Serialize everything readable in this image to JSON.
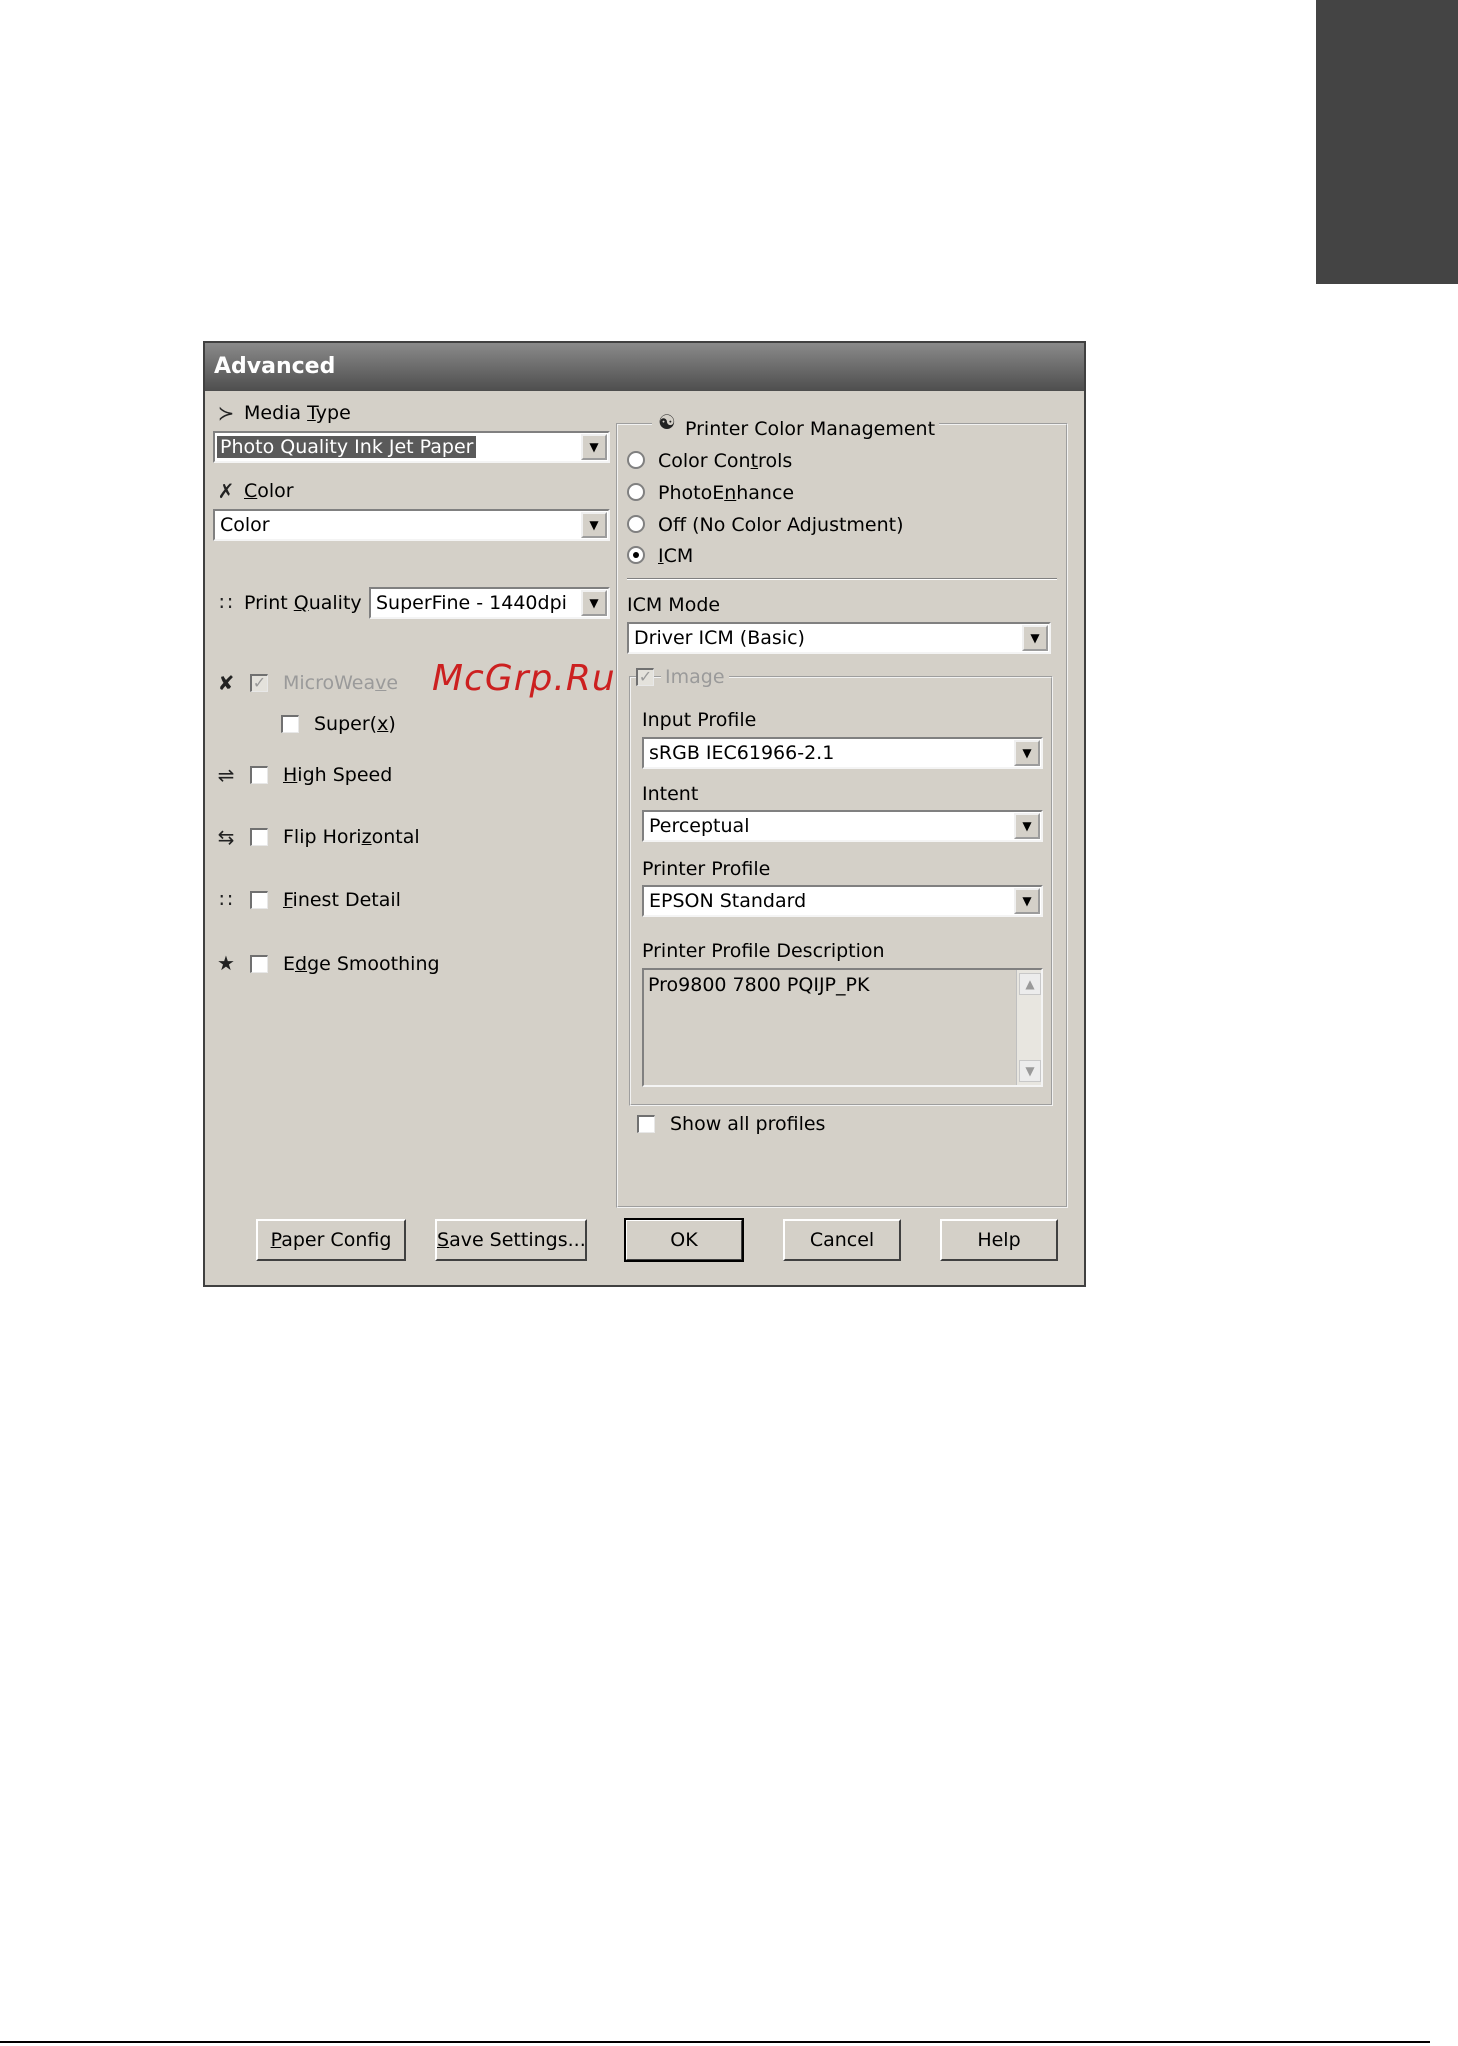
{
  "dialog": {
    "title": "Advanced",
    "media_type": {
      "label_prefix": "Media ",
      "label_access": "T",
      "label_suffix": "ype",
      "value": "Photo Quality Ink Jet Paper"
    },
    "color": {
      "label_access": "C",
      "label_suffix": "olor",
      "value": "Color"
    },
    "print_quality": {
      "label_prefix": "Print ",
      "label_access": "Q",
      "label_suffix": "uality",
      "value": "SuperFine - 1440dpi"
    },
    "options": {
      "microweave": {
        "label_prefix": "MicroWea",
        "label_access": "v",
        "label_suffix": "e",
        "checked": true,
        "disabled": true
      },
      "super": {
        "label_prefix": "Super(",
        "label_access": "x",
        "label_suffix": ")",
        "checked": false
      },
      "high_speed": {
        "label_access": "H",
        "label_suffix": "igh Speed",
        "checked": false
      },
      "flip_horizontal": {
        "label_prefix": "Flip Hori",
        "label_access": "z",
        "label_suffix": "ontal",
        "checked": false
      },
      "finest_detail": {
        "label_access": "F",
        "label_suffix": "inest Detail",
        "checked": false
      },
      "edge_smoothing": {
        "label_prefix": "E",
        "label_access": "d",
        "label_suffix": "ge Smoothing",
        "checked": false
      }
    },
    "color_management": {
      "group_label": "Printer Color Management",
      "radios": [
        {
          "label_prefix": "Color Con",
          "label_access": "t",
          "label_suffix": "rols",
          "selected": false
        },
        {
          "label_prefix": "PhotoE",
          "label_access": "n",
          "label_suffix": "hance",
          "selected": false
        },
        {
          "label_prefix": "Off (No Color Adjustment)",
          "label_access": "",
          "label_suffix": "",
          "selected": false
        },
        {
          "label_prefix": "",
          "label_access": "I",
          "label_suffix": "CM",
          "selected": true
        }
      ],
      "icm_mode_label": "ICM Mode",
      "icm_mode_value": "Driver ICM (Basic)",
      "image": {
        "label": "Image",
        "checked": true,
        "disabled": true,
        "input_profile_label": "Input Profile",
        "input_profile_value": "sRGB IEC61966-2.1",
        "intent_label": "Intent",
        "intent_value": "Perceptual",
        "printer_profile_label": "Printer Profile",
        "printer_profile_value": "EPSON Standard",
        "printer_profile_description_label": "Printer Profile Description",
        "printer_profile_description": "Pro9800 7800 PQIJP_PK"
      },
      "show_all_profiles_label": "Show all profiles",
      "show_all_profiles_checked": false
    },
    "buttons": {
      "paper_config": {
        "access": "P",
        "rest": "aper Config"
      },
      "save_settings": {
        "access": "S",
        "rest": "ave Settings..."
      },
      "ok": "OK",
      "cancel": "Cancel",
      "help": "Help"
    }
  },
  "watermark": "McGrp.Ru",
  "icons": {
    "media_type": "media-type-icon",
    "color": "color-icon",
    "print_quality": "print-quality-icon",
    "microweave": "microweave-icon",
    "high_speed": "high-speed-icon",
    "flip_horizontal": "flip-horizontal-icon",
    "finest_detail": "finest-detail-icon",
    "edge_smoothing": "edge-smoothing-icon",
    "color_management": "color-management-icon"
  },
  "colors": {
    "dialog_face": "#d4d0c8",
    "titlebar": "#5a5a5a",
    "corner_tab": "#444444",
    "watermark": "#cc2020"
  }
}
